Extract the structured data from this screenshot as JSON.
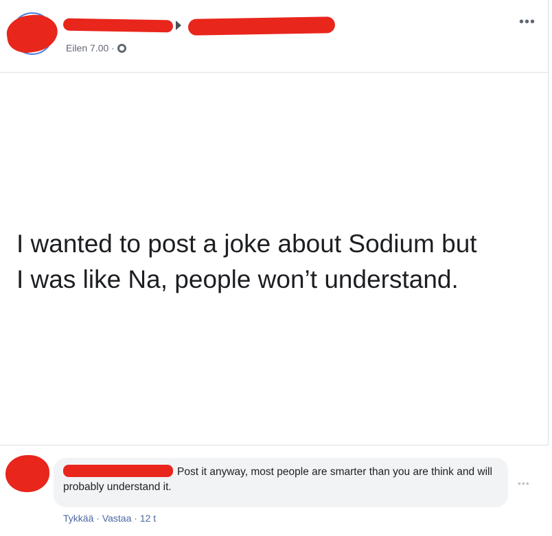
{
  "post": {
    "timestamp": "Eilen 7.00 ·",
    "privacy_icon": "globe-icon",
    "more_label": "•••",
    "text": "I wanted to post a joke about Sodium but\nI was like Na, people won’t understand."
  },
  "comment": {
    "text": "Post it anyway, most people are smarter than you are think and will probably understand it.",
    "more_label": "•••",
    "like_label": "Tykkää",
    "separator": "·",
    "reply_label": "Vastaa",
    "age": "12 t"
  },
  "colors": {
    "redaction": "#e8261c",
    "link": "#4b67a1",
    "bubble": "#f2f3f5"
  }
}
